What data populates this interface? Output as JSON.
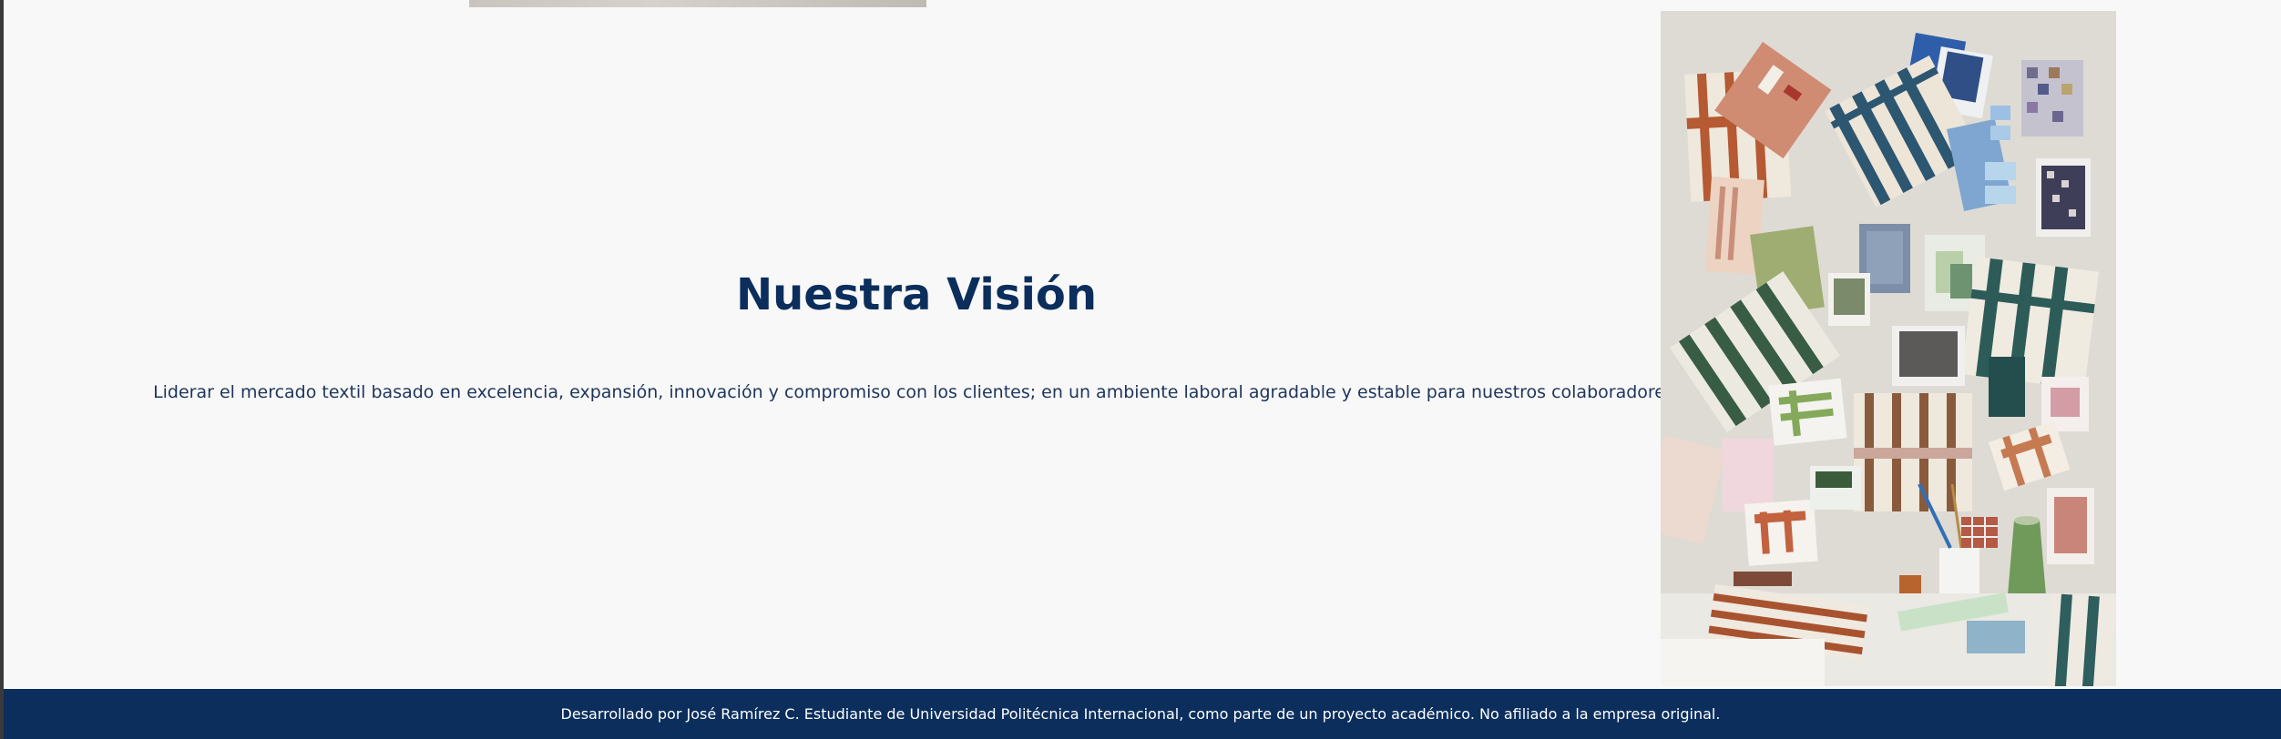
{
  "vision": {
    "title": "Nuestra Visión",
    "text": "Liderar el mercado textil basado en excelencia, expansión, innovación y compromiso con los clientes; en un ambiente laboral agradable y estable para nuestros colaboradores."
  },
  "footer": {
    "text": "Desarrollado por José Ramírez C. Estudiante de Universidad Politécnica Internacional, como parte de un proyecto académico. No afiliado a la empresa original."
  },
  "colors": {
    "brand_navy": "#0b2e5c",
    "background": "#f8f8f8",
    "footer_text": "#ffffff"
  },
  "images": {
    "moodboard": "textile-moodboard-image",
    "top_sliver": "previous-section-image"
  }
}
